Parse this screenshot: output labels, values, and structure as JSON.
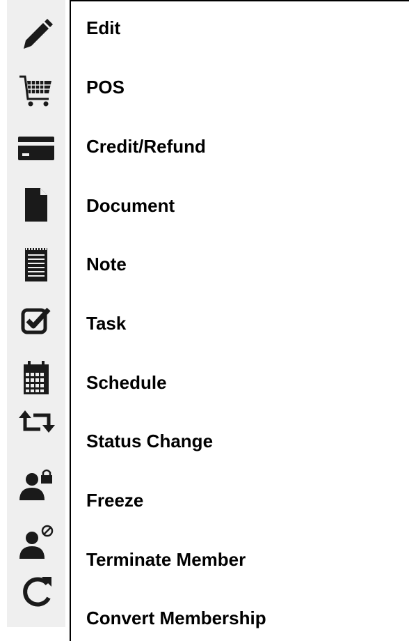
{
  "menu": {
    "items": [
      {
        "label": "Edit",
        "icon": "pencil-icon"
      },
      {
        "label": "POS",
        "icon": "cart-icon"
      },
      {
        "label": "Credit/Refund",
        "icon": "credit-card-icon"
      },
      {
        "label": "Document",
        "icon": "document-icon"
      },
      {
        "label": "Note",
        "icon": "note-icon"
      },
      {
        "label": "Task",
        "icon": "checkbox-icon"
      },
      {
        "label": "Schedule",
        "icon": "calendar-icon"
      },
      {
        "label": "Status Change",
        "icon": "exchange-icon"
      },
      {
        "label": "Freeze",
        "icon": "user-lock-icon"
      },
      {
        "label": "Terminate Member",
        "icon": "user-blocked-icon"
      },
      {
        "label": "Convert Membership",
        "icon": "refresh-icon"
      }
    ]
  },
  "colors": {
    "icon": "#1a1a1a",
    "strip": "#efefef",
    "border": "#000000"
  }
}
